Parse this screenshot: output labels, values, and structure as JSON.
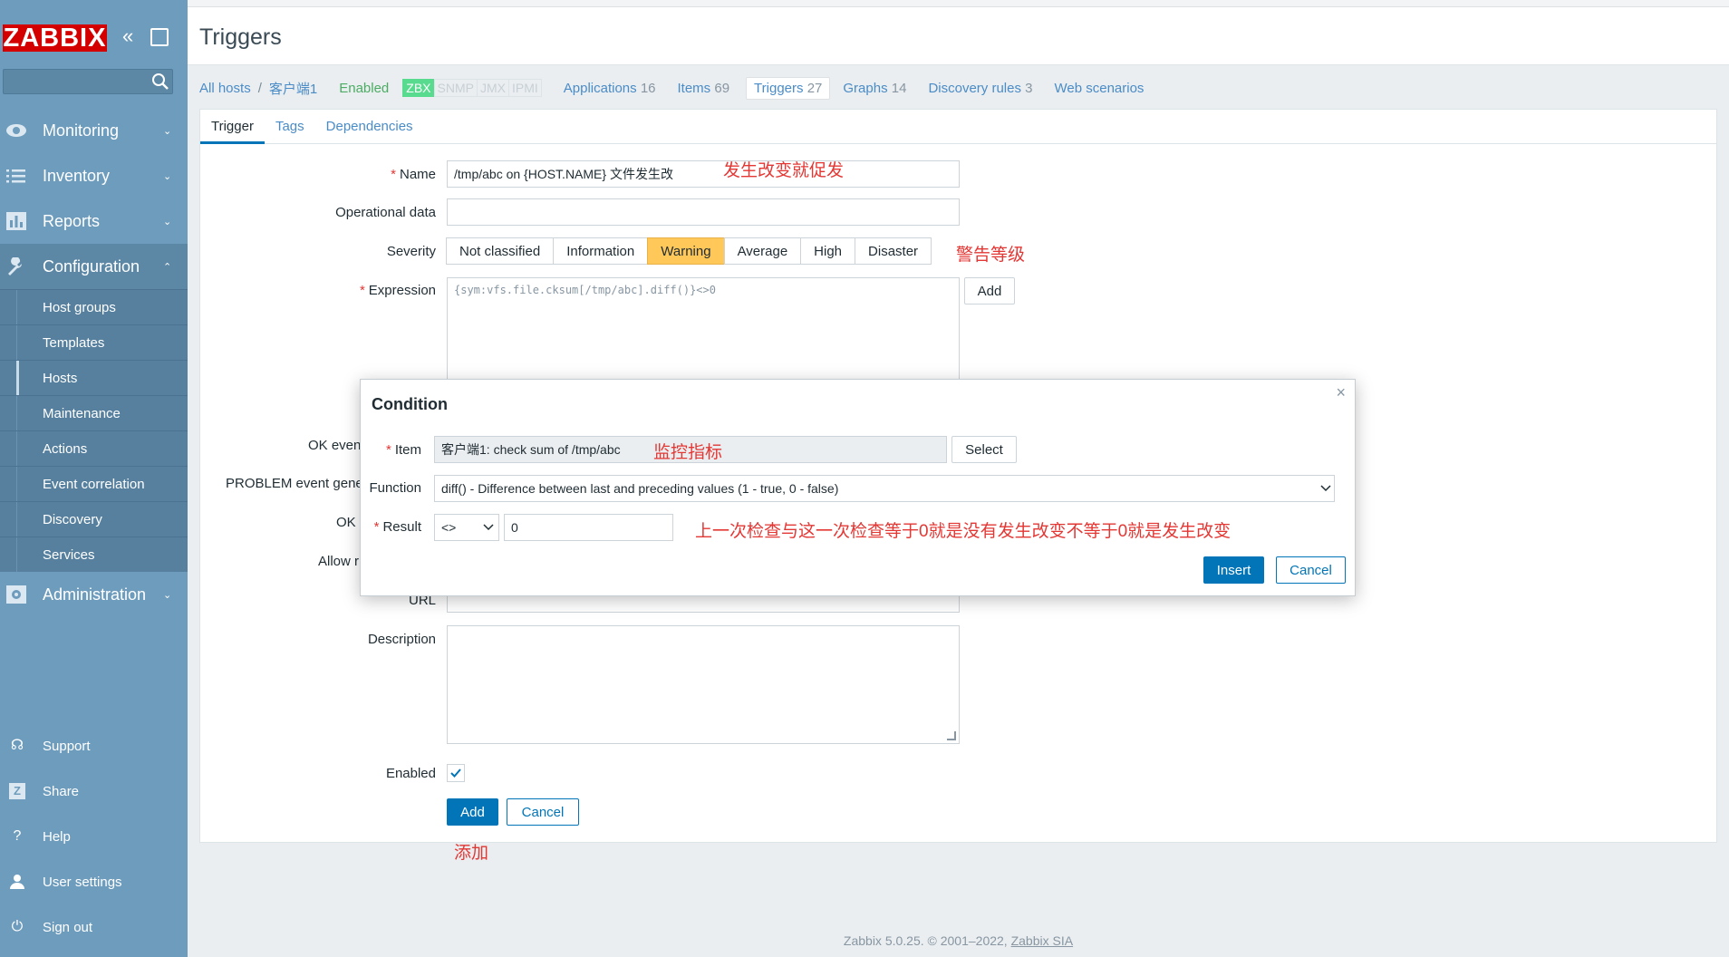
{
  "sidebar": {
    "logo": "ZABBIX",
    "menu": [
      {
        "label": "Monitoring",
        "icon": "eye-icon"
      },
      {
        "label": "Inventory",
        "icon": "list-icon"
      },
      {
        "label": "Reports",
        "icon": "chart-icon"
      },
      {
        "label": "Configuration",
        "icon": "wrench-icon"
      }
    ],
    "configuration_items": [
      "Host groups",
      "Templates",
      "Hosts",
      "Maintenance",
      "Actions",
      "Event correlation",
      "Discovery",
      "Services"
    ],
    "administration": "Administration",
    "bottom": [
      {
        "label": "Support",
        "icon": "headset-icon"
      },
      {
        "label": "Share",
        "icon": "share-icon"
      },
      {
        "label": "Help",
        "icon": "help-icon"
      },
      {
        "label": "User settings",
        "icon": "user-icon"
      },
      {
        "label": "Sign out",
        "icon": "power-icon"
      }
    ]
  },
  "header": {
    "title": "Triggers"
  },
  "hostnav": {
    "all_hosts": "All hosts",
    "host": "客户端1",
    "status": "Enabled",
    "availability": [
      "ZBX",
      "SNMP",
      "JMX",
      "IPMI"
    ],
    "links": [
      {
        "label": "Applications",
        "count": "16"
      },
      {
        "label": "Items",
        "count": "69"
      },
      {
        "label": "Triggers",
        "count": "27"
      },
      {
        "label": "Graphs",
        "count": "14"
      },
      {
        "label": "Discovery rules",
        "count": "3"
      },
      {
        "label": "Web scenarios",
        "count": ""
      }
    ]
  },
  "tabs": [
    "Trigger",
    "Tags",
    "Dependencies"
  ],
  "form": {
    "name_label": "Name",
    "name_value": "/tmp/abc on {HOST.NAME} 文件发生改",
    "opdata_label": "Operational data",
    "severity_label": "Severity",
    "severities": [
      "Not classified",
      "Information",
      "Warning",
      "Average",
      "High",
      "Disaster"
    ],
    "expression_label": "Expression",
    "expression_value": "{sym:vfs.file.cksum[/tmp/abc].diff()}<>0",
    "add_expr": "Add",
    "ok_event_label": "OK even",
    "problem_label": "PROBLEM event gene",
    "ok_label": "OK",
    "allow_label": "Allow r",
    "url_label": "URL",
    "description_label": "Description",
    "enabled_label": "Enabled",
    "add_button": "Add",
    "cancel_button": "Cancel"
  },
  "annotations": {
    "name_note": "发生改变就促发",
    "severity_note": "警告等级",
    "item_note": "监控指标",
    "result_note": "上一次检查与这一次检查等于0就是没有发生改变不等于0就是发生改变",
    "add_note": "添加"
  },
  "modal": {
    "title": "Condition",
    "close": "×",
    "item_label": "Item",
    "item_value": "客户端1: check sum of /tmp/abc",
    "select_button": "Select",
    "function_label": "Function",
    "function_value": "diff() - Difference between last and preceding values (1 - true, 0 - false)",
    "result_label": "Result",
    "operator": "<>",
    "result_value": "0",
    "insert_button": "Insert",
    "cancel_button": "Cancel"
  },
  "footer": {
    "text": "Zabbix 5.0.25. © 2001–2022,",
    "link": "Zabbix SIA"
  },
  "colors": {
    "sidebar": "#6e9cbd",
    "accent": "#0275b8",
    "warning": "#ffc859",
    "annotation": "#e33734"
  }
}
